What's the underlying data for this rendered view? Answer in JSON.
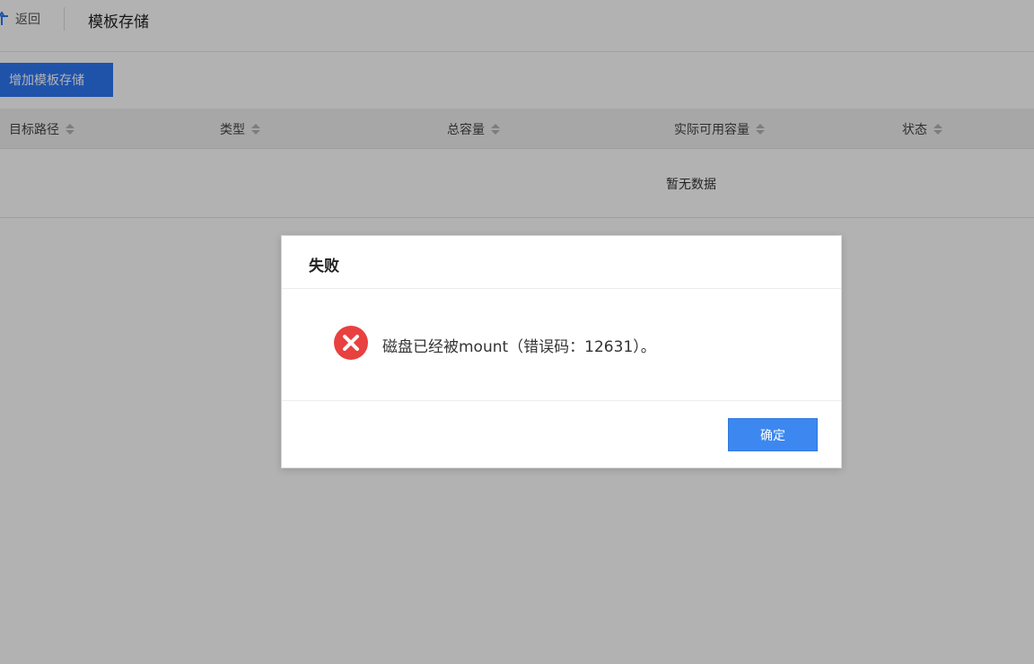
{
  "header": {
    "back_label": "返回",
    "title": "模板存储"
  },
  "toolbar": {
    "add_label": "增加模板存储"
  },
  "table": {
    "columns": [
      "目标路径",
      "类型",
      "总容量",
      "实际可用容量",
      "状态"
    ],
    "empty_text": "暂无数据"
  },
  "dialog": {
    "title": "失败",
    "message": "磁盘已经被mount（错误码：12631）。",
    "ok_label": "确定",
    "icon": "error-x-icon"
  },
  "colors": {
    "primary": "#2d78f4",
    "error": "#e8413f",
    "overlay": "rgba(0,0,0,0.30)"
  }
}
